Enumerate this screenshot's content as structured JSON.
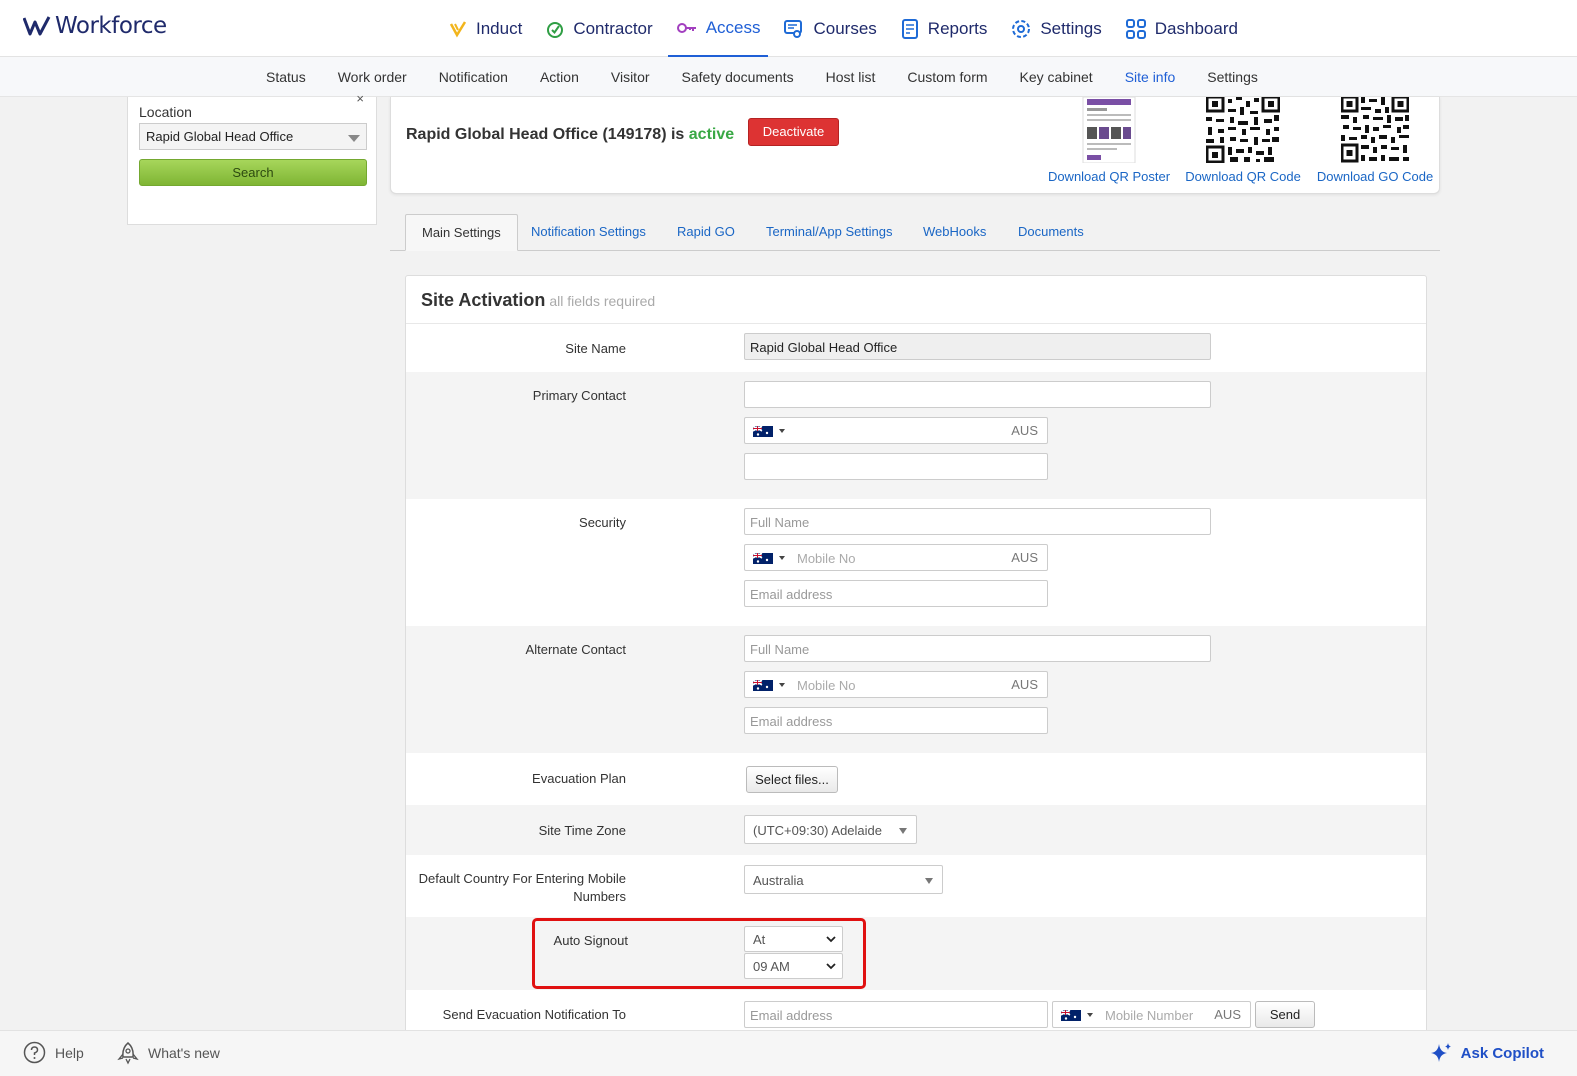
{
  "brand": {
    "name": "Workforce",
    "color": "#1f2a6b"
  },
  "main_nav": [
    {
      "label": "Induct",
      "icon": "induct-icon"
    },
    {
      "label": "Contractor",
      "icon": "contractor-icon"
    },
    {
      "label": "Access",
      "icon": "access-key-icon",
      "active": true
    },
    {
      "label": "Courses",
      "icon": "courses-icon"
    },
    {
      "label": "Reports",
      "icon": "reports-icon"
    },
    {
      "label": "Settings",
      "icon": "gear-icon"
    },
    {
      "label": "Dashboard",
      "icon": "dashboard-grid-icon"
    }
  ],
  "sub_nav": [
    "Status",
    "Work order",
    "Notification",
    "Action",
    "Visitor",
    "Safety documents",
    "Host list",
    "Custom form",
    "Key cabinet",
    "Site info",
    "Settings"
  ],
  "sub_nav_active": "Site info",
  "left_panel": {
    "close": "×",
    "location_label": "Location",
    "location_value": "Rapid Global Head Office",
    "search_label": "Search"
  },
  "site_header": {
    "title_prefix": "Rapid Global Head Office (149178) is ",
    "status": "active",
    "deactivate_label": "Deactivate",
    "downloads": [
      "Download QR Poster",
      "Download QR Code",
      "Download GO Code"
    ]
  },
  "tabs": [
    "Main Settings",
    "Notification Settings",
    "Rapid GO",
    "Terminal/App Settings",
    "WebHooks",
    "Documents"
  ],
  "form": {
    "title": "Site Activation",
    "subtitle": "all fields required",
    "site_name_label": "Site Name",
    "site_name_value": "Rapid Global Head Office",
    "primary_contact_label": "Primary Contact",
    "security_label": "Security",
    "alternate_contact_label": "Alternate Contact",
    "full_name_placeholder": "Full Name",
    "mobile_placeholder": "Mobile No",
    "email_placeholder": "Email address",
    "country_code": "AUS",
    "evacuation_plan_label": "Evacuation Plan",
    "select_files_label": "Select files...",
    "time_zone_label": "Site Time Zone",
    "time_zone_value": "(UTC+09:30) Adelaide",
    "default_country_label": "Default Country For Entering Mobile Numbers",
    "default_country_value": "Australia",
    "auto_signout_label": "Auto Signout",
    "auto_signout_mode": "At",
    "auto_signout_time": "09 AM",
    "evac_notify_label": "Send Evacuation Notification To",
    "mobile_number_placeholder": "Mobile Number",
    "send_label": "Send"
  },
  "bottom_bar": {
    "help": "Help",
    "whats_new": "What's new",
    "copilot": "Ask Copilot"
  }
}
